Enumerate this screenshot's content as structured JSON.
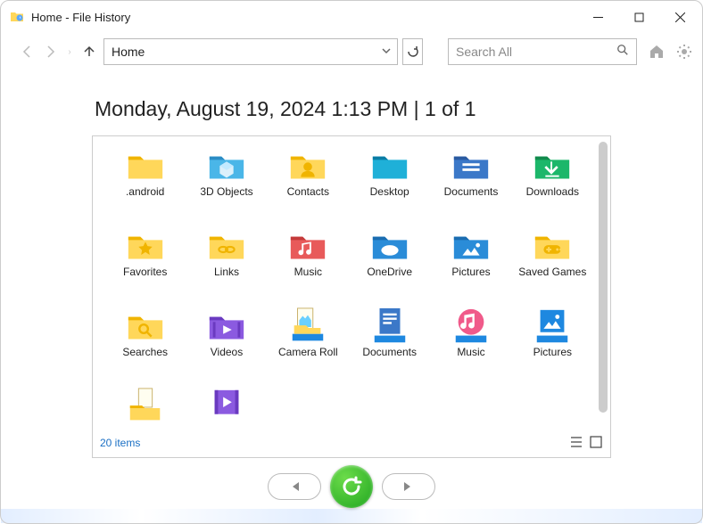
{
  "window": {
    "title": "Home - File History"
  },
  "toolbar": {
    "address": "Home",
    "search_placeholder": "Search All"
  },
  "heading": "Monday, August 19, 2024 1:13 PM   |   1 of 1",
  "items": [
    {
      "label": ".android",
      "icon": "folder-yellow"
    },
    {
      "label": "3D Objects",
      "icon": "folder-3d"
    },
    {
      "label": "Contacts",
      "icon": "folder-contacts"
    },
    {
      "label": "Desktop",
      "icon": "folder-desktop"
    },
    {
      "label": "Documents",
      "icon": "folder-documents"
    },
    {
      "label": "Downloads",
      "icon": "folder-downloads"
    },
    {
      "label": "Favorites",
      "icon": "folder-favorites"
    },
    {
      "label": "Links",
      "icon": "folder-links"
    },
    {
      "label": "Music",
      "icon": "folder-music"
    },
    {
      "label": "OneDrive",
      "icon": "folder-onedrive"
    },
    {
      "label": "Pictures",
      "icon": "folder-pictures"
    },
    {
      "label": "Saved Games",
      "icon": "folder-savedgames"
    },
    {
      "label": "Searches",
      "icon": "folder-searches"
    },
    {
      "label": "Videos",
      "icon": "folder-videos"
    },
    {
      "label": "Camera Roll",
      "icon": "lib-cameraroll"
    },
    {
      "label": "Documents",
      "icon": "lib-documents"
    },
    {
      "label": "Music",
      "icon": "lib-music"
    },
    {
      "label": "Pictures",
      "icon": "lib-pictures"
    },
    {
      "label": "",
      "icon": "folder-doc-yellow"
    },
    {
      "label": "",
      "icon": "folder-video-purple"
    }
  ],
  "status": "20 items",
  "icon_svgs": {
    "folder-yellow": "<svg viewBox='0 0 48 40'><path fill='#ffd75a' d='M4 10h14l4 4h22v22H4z'/><path fill='#f0b400' d='M4 10h14l4 4H4z'/></svg>",
    "folder-3d": "<svg viewBox='0 0 48 40'><path fill='#4ab6e8' d='M4 10h14l4 4h22v22H4z'/><path fill='#2a8cc4' d='M4 10h14l4 4H4z'/><path fill='#fff' fill-opacity='.8' d='M24 16l8 5v9l-8 5-8-5v-9z'/><path fill='#c2eaff' d='M24 16l8 5-8 5-8-5z'/></svg>",
    "folder-contacts": "<svg viewBox='0 0 48 40'><path fill='#ffd75a' d='M4 10h14l4 4h22v22H4z'/><path fill='#f0b400' d='M4 10h14l4 4H4z'/><circle cx='24' cy='22' r='5' fill='#f0b400'/><path fill='#f0b400' d='M16 34c0-5 4-7 8-7s8 2 8 7z'/></svg>",
    "folder-desktop": "<svg viewBox='0 0 48 40'><path fill='#1fb0d8' d='M4 10h14l4 4h22v22H4z'/><path fill='#0a7ca4' d='M4 10h14l4 4H4z'/></svg>",
    "folder-documents": "<svg viewBox='0 0 48 40'><path fill='#3b78c8' d='M4 10h14l4 4h22v22H4z'/><path fill='#2a5aa0' d='M4 10h14l4 4H4z'/><rect x='14' y='18' width='20' height='3' fill='#fff'/><rect x='14' y='24' width='20' height='3' fill='#fff'/></svg>",
    "folder-downloads": "<svg viewBox='0 0 48 40'><path fill='#1cb76a' d='M4 10h14l4 4h22v22H4z'/><path fill='#128a4c' d='M4 10h14l4 4H4z'/><path fill='#fff' d='M24 16v10l5-5 2 2-8 8-8-8 2-2 5 5V16z'/><rect x='16' y='32' width='16' height='2' fill='#fff'/></svg>",
    "folder-favorites": "<svg viewBox='0 0 48 40'><path fill='#ffd75a' d='M4 10h14l4 4h22v22H4z'/><path fill='#f0b400' d='M4 10h14l4 4H4z'/><path fill='#f0b400' d='M24 16l2.5 5 5.5.8-4 4 1 5.5L24 28l-5 3.3 1-5.5-4-4 5.5-.8z'/></svg>",
    "folder-links": "<svg viewBox='0 0 48 40'><path fill='#ffd75a' d='M4 10h14l4 4h22v22H4z'/><path fill='#f0b400' d='M4 10h14l4 4H4z'/><ellipse cx='20' cy='25' rx='5' ry='3.2' fill='none' stroke='#f0b400' stroke-width='2.2'/><ellipse cx='28' cy='25' rx='5' ry='3.2' fill='none' stroke='#f0b400' stroke-width='2.2'/></svg>",
    "folder-music": "<svg viewBox='0 0 48 40'><path fill='#e85a5a' d='M4 10h14l4 4h22v22H4z'/><path fill='#c43a3a' d='M4 10h14l4 4H4z'/><path fill='#fff' d='M28 16v12a3 3 0 11-2-2.8V18l-7 1.5v9a3 3 0 11-2-2.8V18l11-2z'/></svg>",
    "folder-onedrive": "<svg viewBox='0 0 48 40'><path fill='#2a8cd8' d='M4 10h14l4 4h22v22H4z'/><path fill='#1a6cb0' d='M4 10h14l4 4H4z'/><ellipse cx='24' cy='26' rx='10' ry='6' fill='#fff'/></svg>",
    "folder-pictures": "<svg viewBox='0 0 48 40'><path fill='#2a8cd8' d='M4 10h14l4 4h22v22H4z'/><path fill='#1a6cb0' d='M4 10h14l4 4H4z'/><path fill='#fff' d='M14 32l6-8 4 5 4-6 6 9z'/><circle cx='32' cy='20' r='2.5' fill='#fff'/></svg>",
    "folder-savedgames": "<svg viewBox='0 0 48 40'><path fill='#ffd75a' d='M4 10h14l4 4h22v22H4z'/><path fill='#f0b400' d='M4 10h14l4 4H4z'/><rect x='14' y='20' width='20' height='10' rx='5' fill='#f0b400'/><circle cx='30' cy='25' r='1.5' fill='#ffd75a'/><circle cx='34' cy='25' r='1.5' fill='#ffd75a'/><rect x='17' y='24' width='6' height='2' fill='#ffd75a'/><rect x='19' y='22' width='2' height='6' fill='#ffd75a'/></svg>",
    "folder-searches": "<svg viewBox='0 0 48 40'><path fill='#ffd75a' d='M4 10h14l4 4h22v22H4z'/><path fill='#f0b400' d='M4 10h14l4 4H4z'/><circle cx='22' cy='24' r='5' fill='none' stroke='#f0b400' stroke-width='2.5'/><path stroke='#f0b400' stroke-width='2.5' d='M26 28l5 5'/></svg>",
    "folder-videos": "<svg viewBox='0 0 48 40'><path fill='#8b5ae0' d='M4 10h14l4 4h22v22H4z'/><path fill='#6a3ac0' d='M4 10h14l4 4H4z'/><rect x='8' y='16' width='3' height='18' fill='#6a3ac0'/><rect x='37' y='16' width='3' height='18' fill='#6a3ac0'/><path fill='#fff' d='M20 20l10 5-10 5z'/></svg>",
    "lib-cameraroll": "<svg viewBox='0 0 48 44'><rect x='12' y='2' width='18' height='24' fill='#fffef0' stroke='#c8b068'/><path fill='#6ad0ff' d='M14 16l4-5 3 3 3-4 4 6v8H14z'/><rect x='6' y='32' width='36' height='8' fill='#1e88e0'/><path fill='#ffd75a' d='M8 22h14l3 3h14v7H8z'/></svg>",
    "lib-documents": "<svg viewBox='0 0 48 44'><rect x='12' y='2' width='24' height='30' fill='#3b78c8'/><rect x='16' y='8' width='16' height='2.5' fill='#fff'/><rect x='16' y='13' width='16' height='2.5' fill='#fff'/><rect x='16' y='18' width='10' height='2.5' fill='#fff'/><rect x='6' y='34' width='36' height='8' fill='#1e88e0'/></svg>",
    "lib-music": "<svg viewBox='0 0 48 44'><circle cx='24' cy='18' r='15' fill='#f05a8a'/><path fill='#fff' d='M28 8v14a3.5 3.5 0 11-2.5-3.3V12l-7 1.5v9a3.5 3.5 0 11-2.5-3.3V10z'/><rect x='6' y='34' width='36' height='8' fill='#1e88e0'/></svg>",
    "lib-pictures": "<svg viewBox='0 0 48 44'><rect x='10' y='4' width='28' height='26' fill='#1e88e0'/><path fill='#fff' d='M14 26l6-8 4 5 4-6 6 9z'/><circle cx='30' cy='12' r='2.5' fill='#fff'/><rect x='6' y='34' width='36' height='8' fill='#1e88e0'/></svg>",
    "folder-doc-yellow": "<svg viewBox='0 0 48 44'><rect x='16' y='2' width='16' height='22' fill='#fffef0' stroke='#c8b068'/><path fill='#ffd75a' d='M6 22h14l3 3h18v14H6z'/><path fill='#f0b400' d='M6 22h14l3 3H6z'/></svg>",
    "folder-video-purple": "<svg viewBox='0 0 48 44'><rect x='10' y='4' width='28' height='28' fill='#8b5ae0'/><rect x='10' y='4' width='4' height='28' fill='#6a3ac0'/><rect x='34' y='4' width='4' height='28' fill='#6a3ac0'/><path fill='#fff' d='M20 12l10 6-10 6z'/><path fill='#ffd75a' d='M6 28h14l3 3h18v10H6z' fill-opacity='0'/></svg>"
  }
}
